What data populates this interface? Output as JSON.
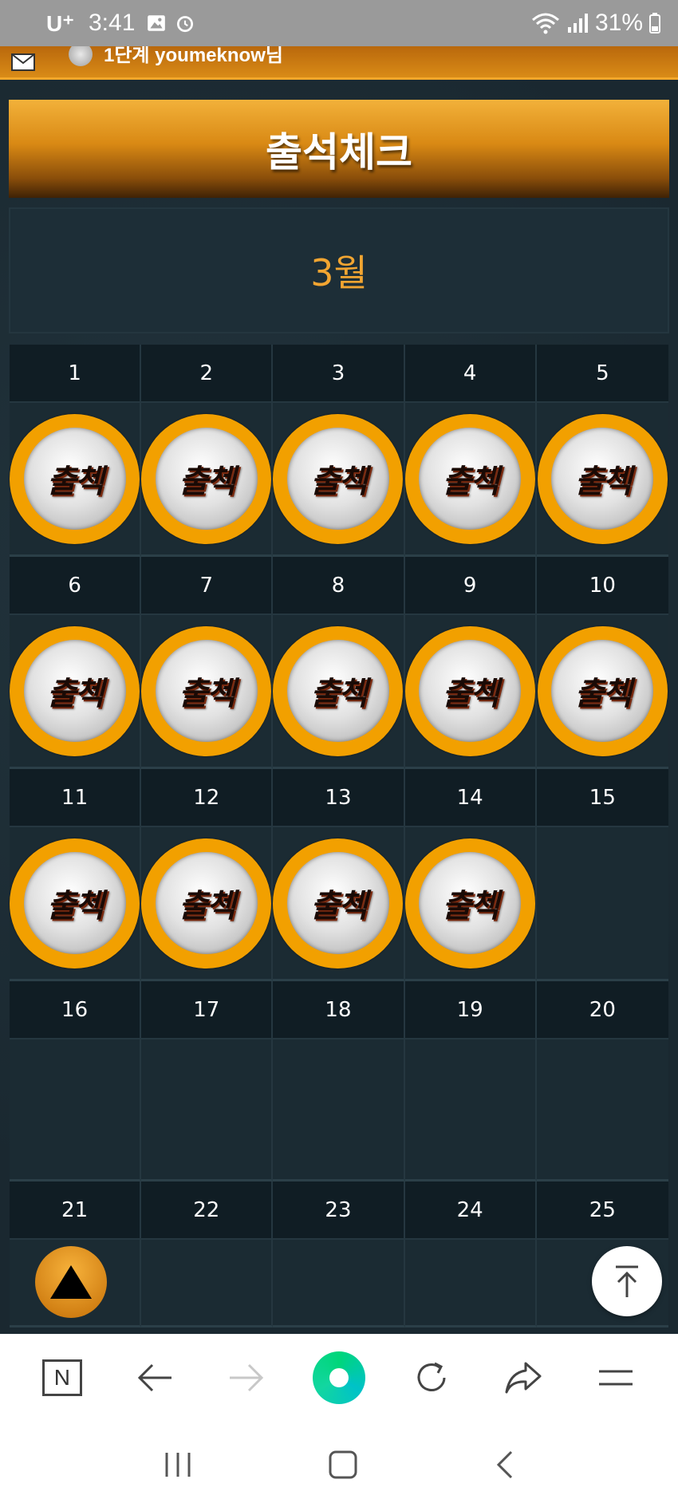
{
  "status_bar": {
    "carrier": "U⁺",
    "time": "3:41",
    "battery": "31%"
  },
  "top_strip": {
    "user_text": "1단계 youmeknow님"
  },
  "title": "출석체크",
  "month": "3월",
  "stamp_label": "출첵",
  "calendar": {
    "rows": [
      {
        "days": [
          "1",
          "2",
          "3",
          "4",
          "5"
        ],
        "stamped": [
          true,
          true,
          true,
          true,
          true
        ]
      },
      {
        "days": [
          "6",
          "7",
          "8",
          "9",
          "10"
        ],
        "stamped": [
          true,
          true,
          true,
          true,
          true
        ]
      },
      {
        "days": [
          "11",
          "12",
          "13",
          "14",
          "15"
        ],
        "stamped": [
          true,
          true,
          true,
          true,
          false
        ]
      },
      {
        "days": [
          "16",
          "17",
          "18",
          "19",
          "20"
        ],
        "stamped": [
          false,
          false,
          false,
          false,
          false
        ]
      },
      {
        "days": [
          "21",
          "22",
          "23",
          "24",
          "25"
        ],
        "stamped": [
          false,
          false,
          false,
          false,
          false
        ]
      }
    ]
  },
  "browser_toolbar": {
    "icons": [
      "naver-home-icon",
      "back-arrow-icon",
      "forward-arrow-icon",
      "green-dot-icon",
      "refresh-icon",
      "share-icon",
      "menu-icon"
    ]
  },
  "colors": {
    "accent_orange": "#f2a000",
    "month_text": "#f2a531",
    "background": "#1c2b33"
  }
}
